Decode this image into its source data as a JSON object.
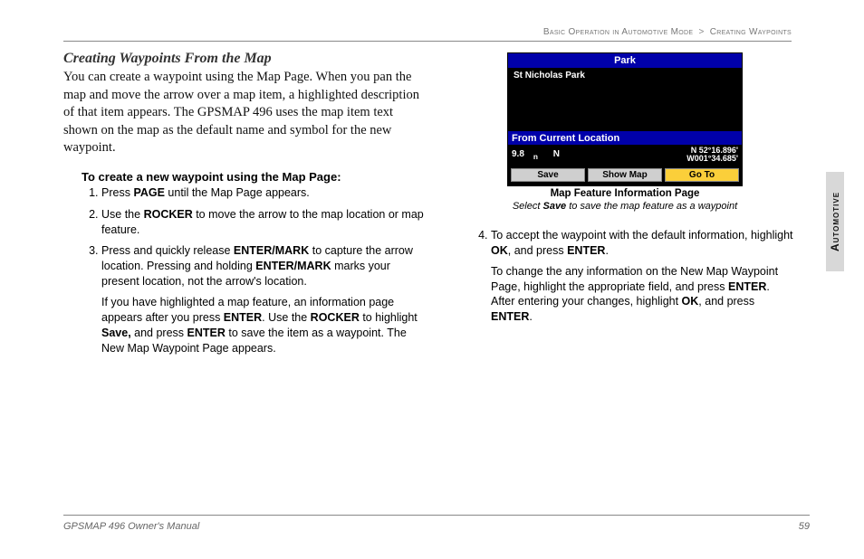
{
  "breadcrumb": {
    "part1": "Basic Operation in Automotive Mode",
    "sep": ">",
    "part2": "Creating Waypoints"
  },
  "heading": "Creating Waypoints From the Map",
  "intro": "You can create a waypoint using the Map Page. When you pan the map and move the arrow over a map item, a highlighted description of that item appears. The GPSMAP 496 uses the map item text shown on the map as the default name and symbol for the new waypoint.",
  "steps_title": "To create a new waypoint using the Map Page:",
  "steps_left": [
    {
      "pre": "Press ",
      "b1": "PAGE",
      "post": " until the Map Page appears."
    },
    {
      "pre": "Use the ",
      "b1": "ROCKER",
      "post": " to move the arrow to the map location or map feature."
    },
    {
      "pre": "Press and quickly release ",
      "b1": "ENTER/MARK",
      "mid1": " to capture the arrow location. Pressing and holding ",
      "b2": "ENTER/MARK",
      "post": " marks your present location, not the arrow's location.",
      "para2_pre": "If you have highlighted a map feature, an information page appears after you press ",
      "para2_b1": "ENTER",
      "para2_mid1": ". Use the ",
      "para2_b2": "ROCKER",
      "para2_mid2": " to highlight ",
      "para2_b3": "Save,",
      "para2_mid3": " and press ",
      "para2_b4": "ENTER",
      "para2_post": " to save the item as a waypoint. The New Map Waypoint Page appears."
    }
  ],
  "device": {
    "title": "Park",
    "feature_name": "St Nicholas Park",
    "fcl_label": "From Current Location",
    "distance": "9.8",
    "unit_sub": "n",
    "heading_dir": "N",
    "coord1": "N 52°16.896'",
    "coord2": "W001°34.685'",
    "buttons": [
      "Save",
      "Show Map",
      "Go To"
    ]
  },
  "figure": {
    "caption": "Map Feature Information Page",
    "sub_pre": "Select ",
    "sub_b": "Save",
    "sub_post": " to save the map feature as a waypoint"
  },
  "step4": {
    "pre": "To accept the waypoint with the default information, highlight ",
    "b1": "OK",
    "mid1": ", and press ",
    "b2": "ENTER",
    "post": ".",
    "p2_pre": "To change the any information on the New Map Waypoint Page, highlight the appropriate field, and press ",
    "p2_b1": "ENTER",
    "p2_mid1": ". After entering your changes, highlight ",
    "p2_b2": "OK",
    "p2_mid2": ", and press ",
    "p2_b3": "ENTER",
    "p2_post": "."
  },
  "sidetab": "Automotive",
  "footer": {
    "left": "GPSMAP 496 Owner's Manual",
    "right": "59"
  }
}
